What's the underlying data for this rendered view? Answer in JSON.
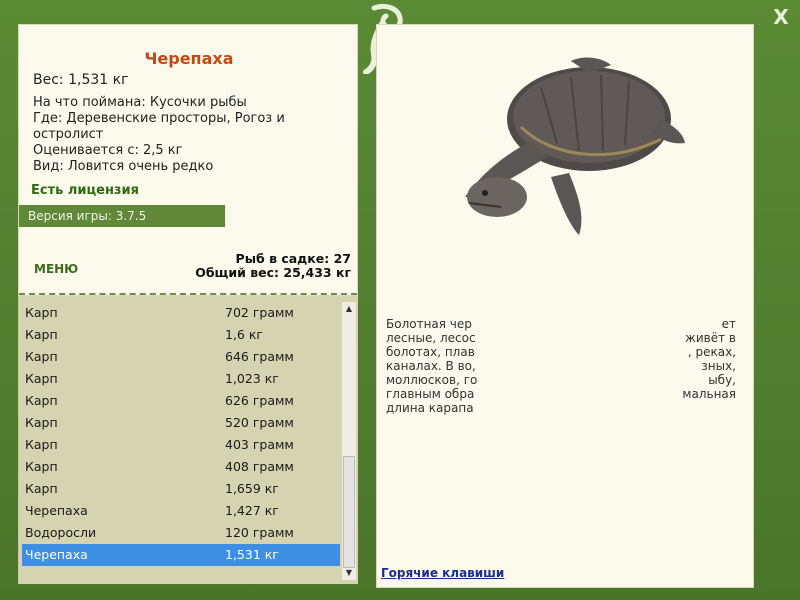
{
  "window": {
    "close_label": "X"
  },
  "fish": {
    "title": "Черепаха",
    "weight": "Вес: 1,531 кг",
    "caught_on": "На что поймана: Кусочки рыбы",
    "location": "Где: Деревенские просторы, Рогоз и остролист",
    "value": "Оценивается с: 2,5 кг",
    "rarity": "Вид: Ловится очень редко",
    "license": "Есть лицензия"
  },
  "version": "Версия игры: 3.7.5",
  "menu_label": "МЕНЮ",
  "stats": {
    "count": "Рыб в садке: 27",
    "total": "Общий вес: 25,433 кг"
  },
  "catch_list": [
    {
      "name": "Карп",
      "weight": "702 грамм"
    },
    {
      "name": "Карп",
      "weight": "1,6 кг"
    },
    {
      "name": "Карп",
      "weight": "646 грамм"
    },
    {
      "name": "Карп",
      "weight": "1,023 кг"
    },
    {
      "name": "Карп",
      "weight": "626 грамм"
    },
    {
      "name": "Карп",
      "weight": "520 грамм"
    },
    {
      "name": "Карп",
      "weight": "403 грамм"
    },
    {
      "name": "Карп",
      "weight": "408 грамм"
    },
    {
      "name": "Карп",
      "weight": "1,659 кг"
    },
    {
      "name": "Черепаха",
      "weight": "1,427 кг"
    },
    {
      "name": "Водоросли",
      "weight": "120 грамм"
    },
    {
      "name": "Черепаха",
      "weight": "1,531 кг"
    }
  ],
  "description_lines": [
    {
      "a": "Болотная чер",
      "b": "ет"
    },
    {
      "a": "лесные, лесос",
      "b": "живёт в"
    },
    {
      "a": "болотах, плав",
      "b": ", реках,"
    },
    {
      "a": "каналах. В во,",
      "b": "зных,"
    },
    {
      "a": "моллюсков, го",
      "b": "ыбу,"
    },
    {
      "a": "главным обра",
      "b": "мальная"
    },
    {
      "a": "длина карапа",
      "b": ""
    }
  ],
  "hotkeys_label": "Горячие клавиши",
  "colors": {
    "frame": "#4f7a2e",
    "title": "#c24b12",
    "selected": "#3d8fe3",
    "panel": "#fbfaec",
    "list": "#d5d4b1"
  }
}
